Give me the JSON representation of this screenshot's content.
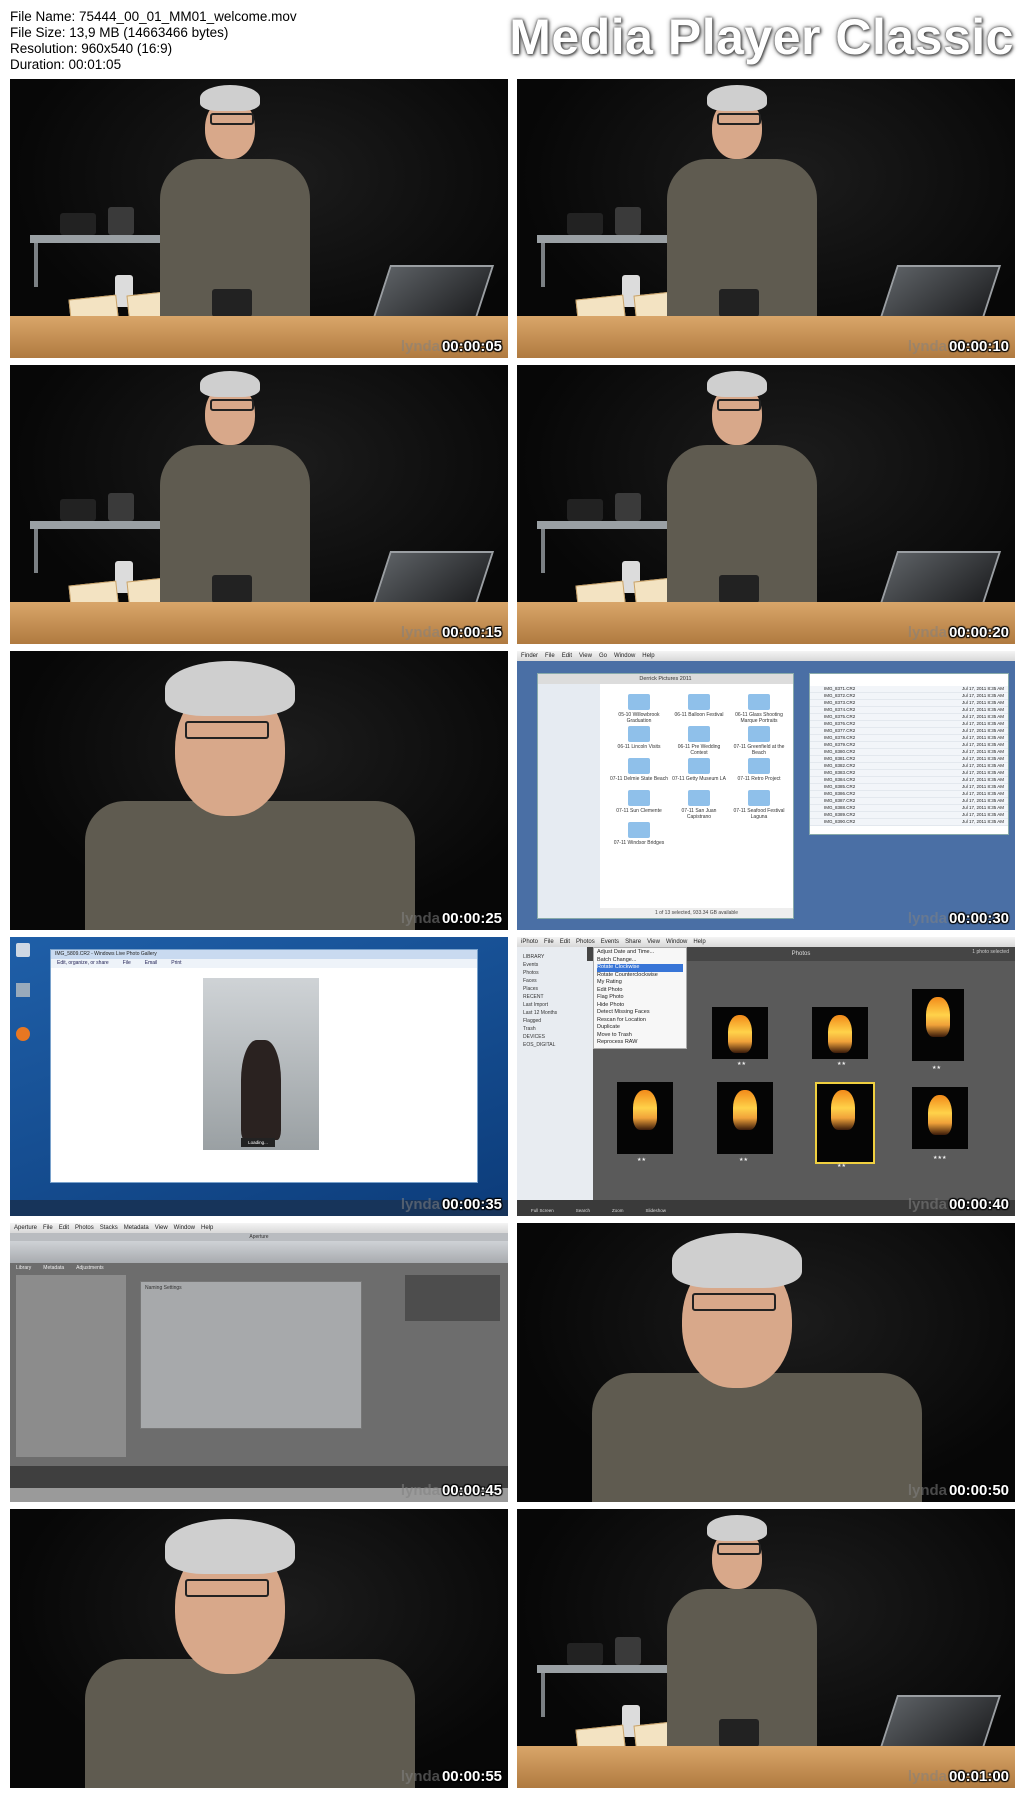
{
  "header": {
    "file_name": "File Name: 75444_00_01_MM01_welcome.mov",
    "file_size": "File Size: 13,9 MB (14663466 bytes)",
    "resolution": "Resolution: 960x540 (16:9)",
    "duration": "Duration: 00:01:05",
    "brand": "Media Player Classic"
  },
  "watermark": "lynda",
  "frames": [
    {
      "timestamp": "00:00:05",
      "scene": "presenter-wide"
    },
    {
      "timestamp": "00:00:10",
      "scene": "presenter-wide"
    },
    {
      "timestamp": "00:00:15",
      "scene": "presenter-wide"
    },
    {
      "timestamp": "00:00:20",
      "scene": "presenter-wide"
    },
    {
      "timestamp": "00:00:25",
      "scene": "presenter-close"
    },
    {
      "timestamp": "00:00:30",
      "scene": "finder"
    },
    {
      "timestamp": "00:00:35",
      "scene": "windows-photo-gallery"
    },
    {
      "timestamp": "00:00:40",
      "scene": "iphoto"
    },
    {
      "timestamp": "00:00:45",
      "scene": "aperture"
    },
    {
      "timestamp": "00:00:50",
      "scene": "presenter-close"
    },
    {
      "timestamp": "00:00:55",
      "scene": "presenter-close"
    },
    {
      "timestamp": "00:01:00",
      "scene": "presenter-wide"
    }
  ],
  "finder": {
    "menubar": [
      "Finder",
      "File",
      "Edit",
      "View",
      "Go",
      "Window",
      "Help"
    ],
    "window_title": "Derrick Pictures 2011",
    "folders": [
      "05-10 Willowbrook Graduation",
      "06-11 Balloon Festival",
      "06-11 Glass Shooting Marque Portraits",
      "06-11 Lincoln Visits",
      "06-11 Pre Wedding Contest",
      "07-11 Greenfield at the Beach",
      "07-11 Delmie State Beach",
      "07-11 Getty Museum LA",
      "07-11 Retro Project",
      "07-11 Sun Clemente",
      "07-11 San Juan Capistrano",
      "07-11 Seafood Festival Laguna",
      "07-11 Windsor Bridges"
    ],
    "status": "1 of 13 selected, 933.34 GB available",
    "files": [
      "IMG_8371.CR2",
      "IMG_8372.CR2",
      "IMG_8373.CR2",
      "IMG_8374.CR2",
      "IMG_8375.CR2",
      "IMG_8376.CR2",
      "IMG_8377.CR2",
      "IMG_8378.CR2",
      "IMG_8379.CR2",
      "IMG_8380.CR2",
      "IMG_8381.CR2",
      "IMG_8382.CR2",
      "IMG_8383.CR2",
      "IMG_8384.CR2",
      "IMG_8385.CR2",
      "IMG_8386.CR2",
      "IMG_8387.CR2",
      "IMG_8388.CR2",
      "IMG_8389.CR2",
      "IMG_8390.CR2"
    ],
    "date": "Jul 17, 2011 8:35 AM"
  },
  "gallery": {
    "title": "IMG_5809.CR2 - Windows Live Photo Gallery",
    "toolbar": [
      "Edit, organize, or share",
      "File",
      "Email",
      "Print"
    ],
    "loading": "Loading..."
  },
  "iphoto": {
    "menubar": [
      "iPhoto",
      "File",
      "Edit",
      "Photos",
      "Events",
      "Share",
      "View",
      "Window",
      "Help"
    ],
    "window_title": "iPhoto",
    "section_title": "Photos",
    "selection": "1 photo selected",
    "menu_items": [
      "Adjust Date and Time...",
      "Batch Change...",
      "Rotate Clockwise",
      "Rotate Counterclockwise",
      "My Rating",
      "Edit Photo",
      "Flag Photo",
      "Hide Photo",
      "Detect Missing Faces",
      "Rescan for Location",
      "Duplicate",
      "Move to Trash",
      "Reprocess RAW"
    ],
    "sidebar": [
      "LIBRARY",
      "Events",
      "Photos",
      "Faces",
      "Places",
      "RECENT",
      "Last Import",
      "Last 12 Months",
      "Flagged",
      "Trash",
      "DEVICES",
      "EOS_DIGITAL"
    ],
    "ratings": [
      "★★",
      "★★",
      "★★",
      "★★",
      "★★",
      "★★",
      "★★★",
      "★★"
    ],
    "bottom": [
      "Full Screen",
      "Search",
      "Zoom",
      "Slideshow"
    ]
  },
  "aperture": {
    "menubar": [
      "Aperture",
      "File",
      "Edit",
      "Photos",
      "Stacks",
      "Metadata",
      "View",
      "Window",
      "Help"
    ],
    "window_title": "Aperture",
    "tabs": [
      "Library",
      "Metadata",
      "Adjustments"
    ],
    "dialog_title": "Naming Settings"
  }
}
